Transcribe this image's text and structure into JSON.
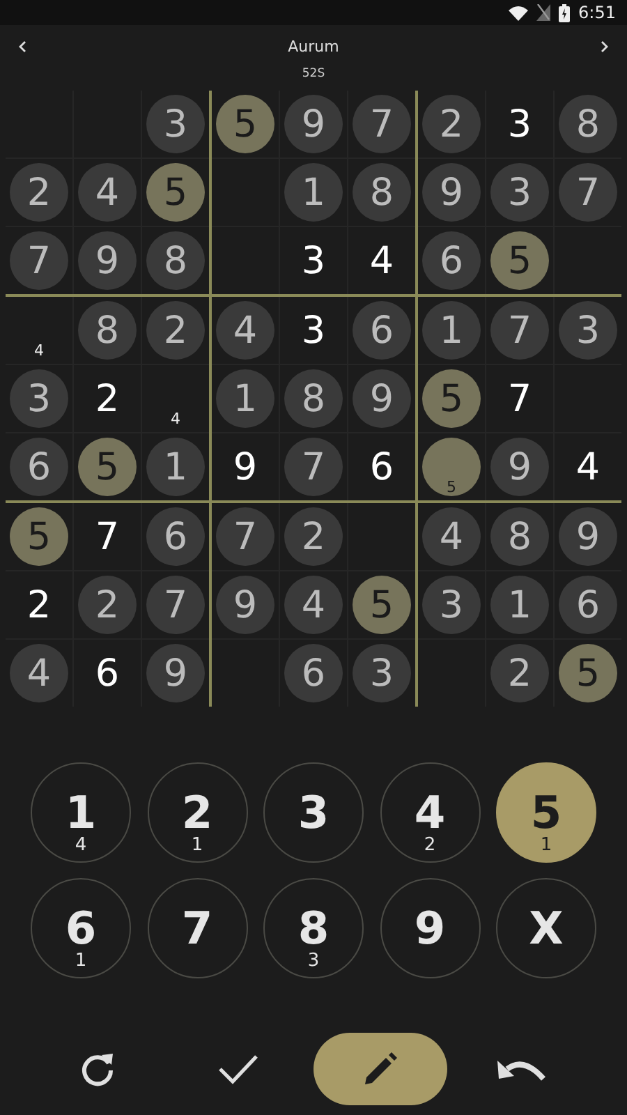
{
  "status_bar": {
    "time": "6:51"
  },
  "header": {
    "title": "Aurum",
    "subtitle": "52S"
  },
  "grid": {
    "rows": [
      [
        {
          "kind": "empty",
          "highlighted": false
        },
        {
          "kind": "empty",
          "highlighted": false
        },
        {
          "kind": "given",
          "value": "3",
          "highlighted": false
        },
        {
          "kind": "given",
          "value": "5",
          "highlighted": true
        },
        {
          "kind": "given",
          "value": "9",
          "highlighted": false
        },
        {
          "kind": "given",
          "value": "7",
          "highlighted": false
        },
        {
          "kind": "given",
          "value": "2",
          "highlighted": false
        },
        {
          "kind": "entered",
          "value": "3",
          "highlighted": false
        },
        {
          "kind": "given",
          "value": "8",
          "highlighted": false
        }
      ],
      [
        {
          "kind": "given",
          "value": "2",
          "highlighted": false
        },
        {
          "kind": "given",
          "value": "4",
          "highlighted": false
        },
        {
          "kind": "given",
          "value": "5",
          "highlighted": true
        },
        {
          "kind": "empty",
          "highlighted": false
        },
        {
          "kind": "given",
          "value": "1",
          "highlighted": false
        },
        {
          "kind": "given",
          "value": "8",
          "highlighted": false
        },
        {
          "kind": "given",
          "value": "9",
          "highlighted": false
        },
        {
          "kind": "given",
          "value": "3",
          "highlighted": false
        },
        {
          "kind": "given",
          "value": "7",
          "highlighted": false
        }
      ],
      [
        {
          "kind": "given",
          "value": "7",
          "highlighted": false
        },
        {
          "kind": "given",
          "value": "9",
          "highlighted": false
        },
        {
          "kind": "given",
          "value": "8",
          "highlighted": false
        },
        {
          "kind": "empty",
          "highlighted": false
        },
        {
          "kind": "entered",
          "value": "3",
          "highlighted": false
        },
        {
          "kind": "entered",
          "value": "4",
          "highlighted": false
        },
        {
          "kind": "given",
          "value": "6",
          "highlighted": false
        },
        {
          "kind": "given",
          "value": "5",
          "highlighted": true
        },
        {
          "kind": "empty",
          "highlighted": false
        }
      ],
      [
        {
          "kind": "note",
          "value": "4",
          "highlighted": false
        },
        {
          "kind": "given",
          "value": "8",
          "highlighted": false
        },
        {
          "kind": "given",
          "value": "2",
          "highlighted": false
        },
        {
          "kind": "given",
          "value": "4",
          "highlighted": false
        },
        {
          "kind": "entered",
          "value": "3",
          "highlighted": false
        },
        {
          "kind": "given",
          "value": "6",
          "highlighted": false
        },
        {
          "kind": "given",
          "value": "1",
          "highlighted": false
        },
        {
          "kind": "given",
          "value": "7",
          "highlighted": false
        },
        {
          "kind": "given",
          "value": "3",
          "highlighted": false
        }
      ],
      [
        {
          "kind": "given",
          "value": "3",
          "highlighted": false
        },
        {
          "kind": "entered",
          "value": "2",
          "highlighted": false
        },
        {
          "kind": "note",
          "value": "4",
          "highlighted": false
        },
        {
          "kind": "given",
          "value": "1",
          "highlighted": false
        },
        {
          "kind": "given",
          "value": "8",
          "highlighted": false
        },
        {
          "kind": "given",
          "value": "9",
          "highlighted": false
        },
        {
          "kind": "given",
          "value": "5",
          "highlighted": true
        },
        {
          "kind": "entered",
          "value": "7",
          "highlighted": false
        },
        {
          "kind": "empty",
          "highlighted": false
        }
      ],
      [
        {
          "kind": "given",
          "value": "6",
          "highlighted": false
        },
        {
          "kind": "given",
          "value": "5",
          "highlighted": true
        },
        {
          "kind": "given",
          "value": "1",
          "highlighted": false
        },
        {
          "kind": "entered",
          "value": "9",
          "highlighted": false
        },
        {
          "kind": "given",
          "value": "7",
          "highlighted": false
        },
        {
          "kind": "entered",
          "value": "6",
          "highlighted": false
        },
        {
          "kind": "note",
          "value": "5",
          "highlighted": true
        },
        {
          "kind": "given",
          "value": "9",
          "highlighted": false
        },
        {
          "kind": "entered",
          "value": "4",
          "highlighted": false
        }
      ],
      [
        {
          "kind": "given",
          "value": "5",
          "highlighted": true
        },
        {
          "kind": "entered",
          "value": "7",
          "highlighted": false
        },
        {
          "kind": "given",
          "value": "6",
          "highlighted": false
        },
        {
          "kind": "given",
          "value": "7",
          "highlighted": false
        },
        {
          "kind": "given",
          "value": "2",
          "highlighted": false
        },
        {
          "kind": "empty",
          "highlighted": false
        },
        {
          "kind": "given",
          "value": "4",
          "highlighted": false
        },
        {
          "kind": "given",
          "value": "8",
          "highlighted": false
        },
        {
          "kind": "given",
          "value": "9",
          "highlighted": false
        }
      ],
      [
        {
          "kind": "entered",
          "value": "2",
          "highlighted": false
        },
        {
          "kind": "given",
          "value": "2",
          "highlighted": false
        },
        {
          "kind": "given",
          "value": "7",
          "highlighted": false
        },
        {
          "kind": "given",
          "value": "9",
          "highlighted": false
        },
        {
          "kind": "given",
          "value": "4",
          "highlighted": false
        },
        {
          "kind": "given",
          "value": "5",
          "highlighted": true
        },
        {
          "kind": "given",
          "value": "3",
          "highlighted": false
        },
        {
          "kind": "given",
          "value": "1",
          "highlighted": false
        },
        {
          "kind": "given",
          "value": "6",
          "highlighted": false
        }
      ],
      [
        {
          "kind": "given",
          "value": "4",
          "highlighted": false
        },
        {
          "kind": "entered",
          "value": "6",
          "highlighted": false
        },
        {
          "kind": "given",
          "value": "9",
          "highlighted": false
        },
        {
          "kind": "empty",
          "highlighted": false
        },
        {
          "kind": "given",
          "value": "6",
          "highlighted": false
        },
        {
          "kind": "given",
          "value": "3",
          "highlighted": false
        },
        {
          "kind": "empty",
          "highlighted": false
        },
        {
          "kind": "given",
          "value": "2",
          "highlighted": false
        },
        {
          "kind": "given",
          "value": "5",
          "highlighted": true
        }
      ]
    ]
  },
  "keypad": [
    {
      "label": "1",
      "count": "4",
      "selected": false
    },
    {
      "label": "2",
      "count": "1",
      "selected": false
    },
    {
      "label": "3",
      "selected": false
    },
    {
      "label": "4",
      "count": "2",
      "selected": false
    },
    {
      "label": "5",
      "count": "1",
      "selected": true
    },
    {
      "label": "6",
      "count": "1",
      "selected": false
    },
    {
      "label": "7",
      "selected": false
    },
    {
      "label": "8",
      "count": "3",
      "selected": false
    },
    {
      "label": "9",
      "selected": false
    },
    {
      "label": "X",
      "selected": false
    }
  ],
  "actions": [
    {
      "kind": "restart",
      "selected": false
    },
    {
      "kind": "check",
      "selected": false
    },
    {
      "kind": "pencil",
      "selected": true
    },
    {
      "kind": "undo",
      "selected": false
    }
  ]
}
